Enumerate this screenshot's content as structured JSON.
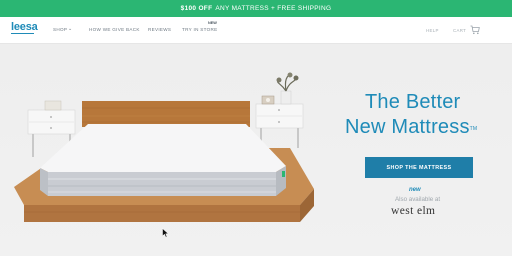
{
  "promo": {
    "bold": "$100 OFF",
    "rest": "ANY MATTRESS + FREE SHIPPING"
  },
  "nav": {
    "logo": "leesa",
    "shop": "SHOP",
    "give_back": "HOW WE GIVE BACK",
    "reviews": "REVIEWS",
    "try_in_store": "TRY IN STORE",
    "new_badge": "NEW",
    "help": "HELP",
    "cart": "CART"
  },
  "hero": {
    "headline_line1": "The Better",
    "headline_line2": "New Mattress",
    "tm": "TM",
    "cta": "SHOP THE MATTRESS",
    "new_tag": "new",
    "also_available": "Also available at",
    "partner": "west elm"
  },
  "colors": {
    "promo_bg": "#2bb673",
    "brand": "#1f8bb8",
    "cta_bg": "#1f7ea8"
  }
}
